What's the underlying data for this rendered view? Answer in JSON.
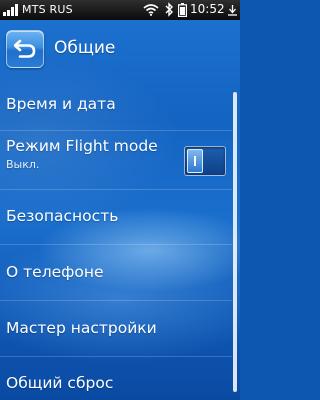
{
  "status_bar": {
    "carrier": "MTS RUS",
    "time": "10:52"
  },
  "header": {
    "title": "Общие"
  },
  "menu": {
    "items": [
      {
        "label": "Время и дата"
      },
      {
        "label": "Режим Flight mode",
        "sublabel": "Выкл.",
        "toggle_on": false
      },
      {
        "label": "Безопасность"
      },
      {
        "label": "О телефоне"
      },
      {
        "label": "Мастер настройки"
      },
      {
        "label": "Общий сброс"
      }
    ]
  },
  "colors": {
    "background": "#1464c2",
    "status_bar": "#0a0a0a",
    "text": "#ffffff"
  },
  "icons": {
    "status_bar": [
      "signal-icon",
      "wifi-icon",
      "bluetooth-icon",
      "battery-icon",
      "sync-icon"
    ],
    "header": [
      "back-arrow-icon"
    ]
  }
}
